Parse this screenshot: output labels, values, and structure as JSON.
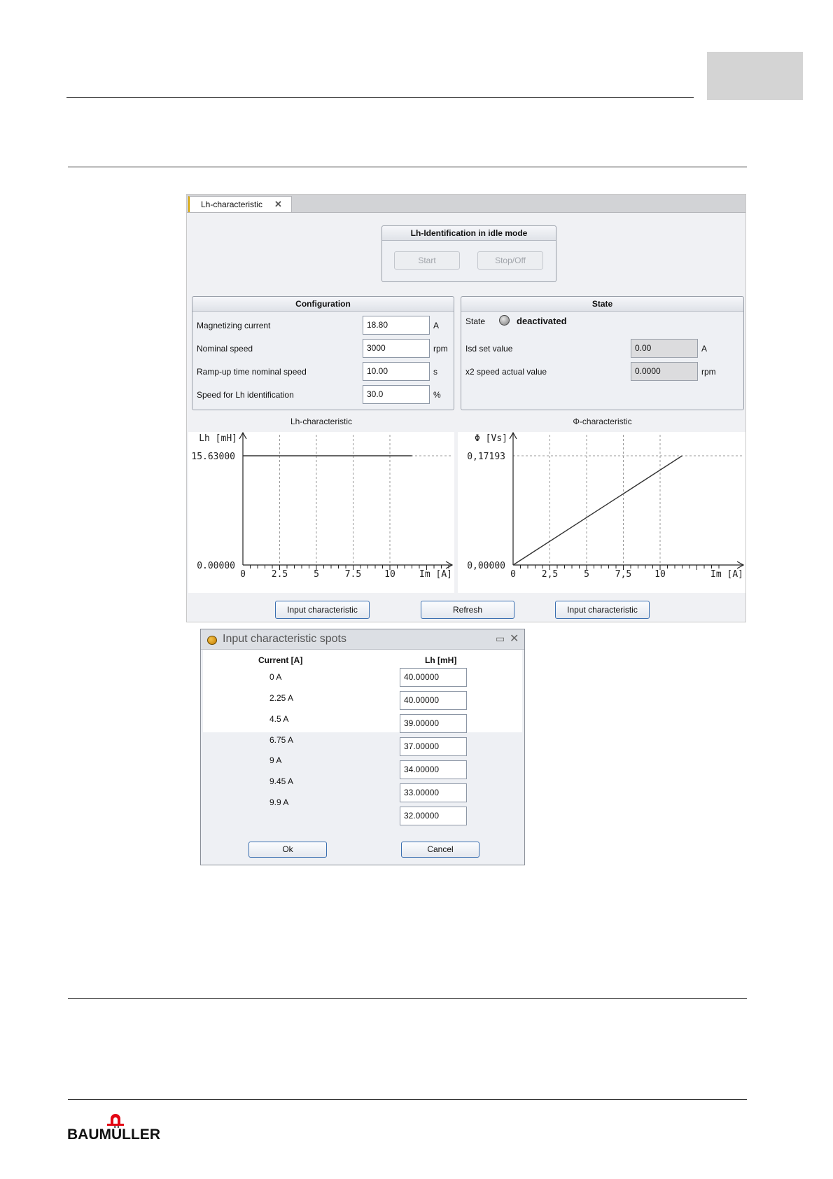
{
  "tab": {
    "label": "Lh-characteristic",
    "close_glyph": "✕"
  },
  "idle": {
    "title": "Lh-Identification in idle mode",
    "start": "Start",
    "stop": "Stop/Off"
  },
  "config": {
    "title": "Configuration",
    "rows": [
      {
        "label": "Magnetizing current",
        "value": "18.80",
        "unit": "A"
      },
      {
        "label": "Nominal speed",
        "value": "3000",
        "unit": "rpm"
      },
      {
        "label": "Ramp-up time nominal speed",
        "value": "10.00",
        "unit": "s"
      },
      {
        "label": "Speed for Lh identification",
        "value": "30.0",
        "unit": "%"
      }
    ]
  },
  "state": {
    "title": "State",
    "state_label": "State",
    "state_value": "deactivated",
    "rows": [
      {
        "label": "Isd set value",
        "value": "0.00",
        "unit": "A"
      },
      {
        "label": "x2 speed actual value",
        "value": "0.0000",
        "unit": "rpm"
      }
    ]
  },
  "chart_data": [
    {
      "type": "line",
      "title": "Lh-characteristic",
      "ylabel": "Lh [mH]",
      "xlabel": "Im [A]",
      "y_top_label": "15.63000",
      "y_bottom_label": "0.00000",
      "x_ticks": [
        "0",
        "2.5",
        "5",
        "7.5",
        "10"
      ],
      "xlim": [
        0,
        15
      ],
      "ylim": [
        0,
        15.63
      ],
      "grid": true,
      "series": [
        {
          "x": [
            0,
            11.5
          ],
          "y": [
            15.63,
            15.63
          ]
        }
      ]
    },
    {
      "type": "line",
      "title": "Φ-characteristic",
      "ylabel": "Φ [Vs]",
      "xlabel": "Im [A]",
      "y_top_label": "0,17193",
      "y_bottom_label": "0,00000",
      "x_ticks": [
        "0",
        "2,5",
        "5",
        "7,5",
        "10"
      ],
      "xlim": [
        0,
        15
      ],
      "ylim": [
        0,
        0.17193
      ],
      "grid": true,
      "series": [
        {
          "x": [
            0,
            11.5
          ],
          "y": [
            0,
            0.17193
          ]
        }
      ]
    }
  ],
  "buttons": {
    "input_left": "Input characteristic",
    "refresh": "Refresh",
    "input_right": "Input characteristic"
  },
  "dialog": {
    "title": "Input characteristic spots",
    "col_current": "Current [A]",
    "col_lh": "Lh [mH]",
    "currents": [
      "0 A",
      "2.25 A",
      "4.5 A",
      "6.75 A",
      "9 A",
      "9.45 A",
      "9.9 A"
    ],
    "values": [
      "40.00000",
      "40.00000",
      "39.00000",
      "37.00000",
      "34.00000",
      "33.00000",
      "32.00000"
    ],
    "ok": "Ok",
    "cancel": "Cancel"
  },
  "logo": {
    "text": "BAUMÜLLER",
    "color": "#e30613"
  }
}
